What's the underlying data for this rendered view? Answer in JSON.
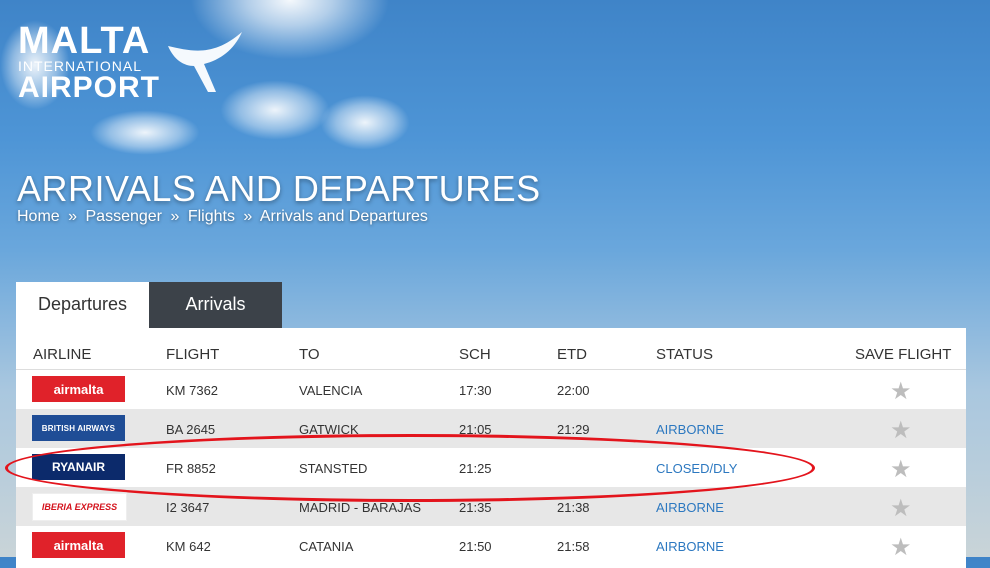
{
  "brand": {
    "line1": "MALTA",
    "line2": "INTERNATIONAL",
    "line3": "AIRPORT"
  },
  "page": {
    "title": "ARRIVALS AND DEPARTURES",
    "breadcrumb": [
      "Home",
      "»",
      "Passenger",
      "»",
      "Flights",
      "»",
      "Arrivals and Departures"
    ]
  },
  "tabs": [
    {
      "label": "Departures",
      "active": true
    },
    {
      "label": "Arrivals",
      "active": false
    }
  ],
  "table": {
    "headers": {
      "airline": "AIRLINE",
      "flight": "FLIGHT",
      "to": "TO",
      "sch": "SCH",
      "etd": "ETD",
      "status": "STATUS",
      "save": "SAVE FLIGHT"
    },
    "rows": [
      {
        "airline_logo": "airmalta",
        "flight": "KM 7362",
        "to": "VALENCIA",
        "sch": "17:30",
        "etd": "22:00",
        "status": ""
      },
      {
        "airline_logo": "BRITISH AIRWAYS",
        "flight": "BA 2645",
        "to": "GATWICK",
        "sch": "21:05",
        "etd": "21:29",
        "status": "AIRBORNE"
      },
      {
        "airline_logo": "RYANAIR",
        "flight": "FR 8852",
        "to": "STANSTED",
        "sch": "21:25",
        "etd": "",
        "status": "CLOSED/DLY"
      },
      {
        "airline_logo": "IBERIA EXPRESS",
        "flight": "I2 3647",
        "to": "MADRID - BARAJAS",
        "sch": "21:35",
        "etd": "21:38",
        "status": "AIRBORNE"
      },
      {
        "airline_logo": "airmalta",
        "flight": "KM 642",
        "to": "CATANIA",
        "sch": "21:50",
        "etd": "21:58",
        "status": "AIRBORNE"
      }
    ],
    "save_icon": "star-icon"
  },
  "colors": {
    "status_link": "#2c78c0",
    "highlight": "#e3141c",
    "tab_inactive": "#3c4249"
  }
}
